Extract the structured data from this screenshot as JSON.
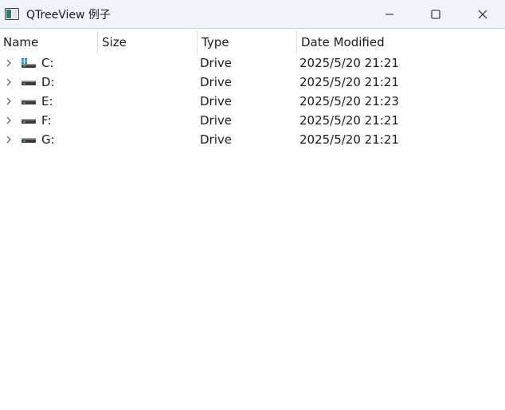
{
  "window": {
    "title": "QTreeView 例子",
    "icons": {
      "app": "window-icon",
      "minimize": "minimize-icon",
      "maximize": "maximize-icon",
      "close": "close-icon"
    }
  },
  "tree": {
    "columns": [
      "Name",
      "Size",
      "Type",
      "Date Modified"
    ],
    "rows": [
      {
        "name": "C:",
        "size": "",
        "type": "Drive",
        "modified": "2025/5/20 21:21",
        "icon": "system-drive-icon"
      },
      {
        "name": "D:",
        "size": "",
        "type": "Drive",
        "modified": "2025/5/20 21:21",
        "icon": "drive-icon"
      },
      {
        "name": "E:",
        "size": "",
        "type": "Drive",
        "modified": "2025/5/20 21:23",
        "icon": "drive-icon"
      },
      {
        "name": "F:",
        "size": "",
        "type": "Drive",
        "modified": "2025/5/20 21:21",
        "icon": "drive-icon"
      },
      {
        "name": "G:",
        "size": "",
        "type": "Drive",
        "modified": "2025/5/20 21:21",
        "icon": "drive-icon"
      }
    ]
  }
}
